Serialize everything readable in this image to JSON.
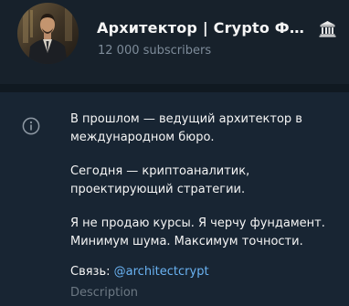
{
  "channel": {
    "title": "Архитектор | Crypto Фундаментал",
    "subscribers": "12 000 subscribers",
    "badge_icon": "bank-icon"
  },
  "about": {
    "icon": "info-icon",
    "paragraphs": [
      "В прошлом — ведущий архитектор в международном бюро.",
      "Сегодня — криптоаналитик, проектирующий стратегии.",
      "Я не продаю курсы. Я черчу фундамент. Минимум шума. Максимум точности."
    ],
    "contact_label": "Связь: ",
    "contact_link": "@architectcrypt",
    "section_label": "Description"
  },
  "colors": {
    "background": "#182533",
    "header_bg": "#17212b",
    "text": "#f5f5f5",
    "muted": "#7d8b99",
    "link": "#6ab3f3"
  }
}
